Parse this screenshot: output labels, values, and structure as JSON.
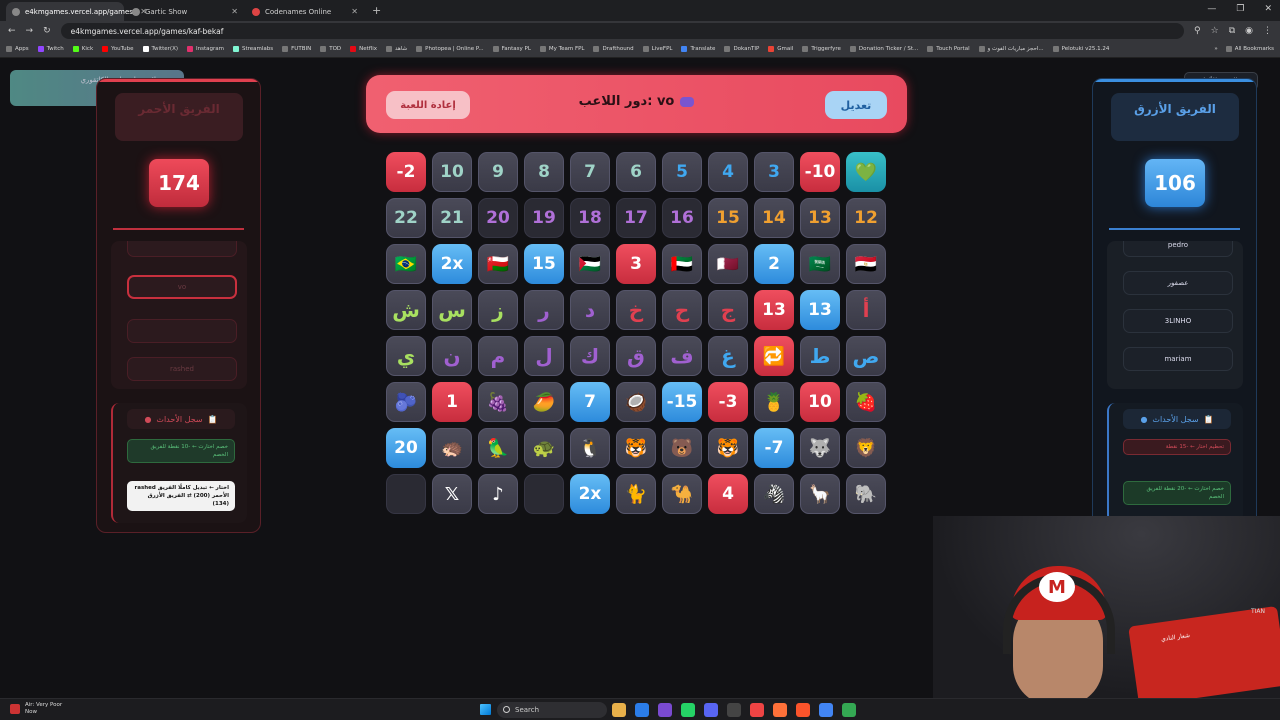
{
  "browser": {
    "tabs": [
      {
        "label": "e4kmgames.vercel.app/games/",
        "active": true
      },
      {
        "label": "Gartic Show",
        "active": false
      },
      {
        "label": "Codenames Online",
        "active": false
      }
    ],
    "new_tab": "+",
    "url": "e4kmgames.vercel.app/games/kaf-bekaf",
    "bookmarks": [
      "Apps",
      "Twitch",
      "Kick",
      "YouTube",
      "Twitter(X)",
      "Instagram",
      "Streamlabs",
      "FUTBIN",
      "TOD",
      "Netflix",
      "شاهد",
      "Photopea | Online P...",
      "Fantasy PL",
      "My Team FPL",
      "Drafthound",
      "LiveFPL",
      "Translate",
      "DokanTIP",
      "Gmail",
      "Triggerfyre",
      "Donation Ticker / St...",
      "Touch Portal",
      "احجز مباريات الفوت و...",
      "Pelotuki v25.1.24"
    ],
    "all_bookmarks": "All Bookmarks"
  },
  "toast": {
    "line1": "لا تنسوا تحطون الكاتقوري",
    "line2": "للعبة"
  },
  "back_button": "العودة للألعاب →",
  "header": {
    "restart": "إعادة اللعبة",
    "turn": "دور اللاعب: vo",
    "edit": "تعديل"
  },
  "red_team": {
    "title": "الفريق الأحمر",
    "score": "174",
    "players": [
      "",
      "vo",
      "",
      "rashed"
    ],
    "log_title": "سجل الأحداث",
    "log": [
      {
        "text": "خصم اختارت ← -10 نقطة للفريق الخصم",
        "style": "green"
      },
      {
        "text": "rashed اختار ← تبديل كاملًا الفريق الأحمر (200) ⇄ الفريق الأزرق (134)",
        "style": "white"
      }
    ]
  },
  "blue_team": {
    "title": "الفريق الأزرق",
    "score": "106",
    "players": [
      "pedro",
      "عصفور",
      "3LINHO",
      "mariam"
    ],
    "log_title": "سجل الأحداث",
    "log": [
      {
        "text": "تحطيم اختار ← -15 نقطة",
        "style": "red"
      },
      {
        "text": "خصم اختارت ← -20 نقطة للفريق الخصم",
        "style": "green"
      }
    ]
  },
  "board": [
    [
      "-2",
      "10",
      "9",
      "8",
      "7",
      "6",
      "5",
      "4",
      "3",
      "-10",
      "💚"
    ],
    [
      "22",
      "21",
      "20",
      "19",
      "18",
      "17",
      "16",
      "15",
      "14",
      "13",
      "12"
    ],
    [
      "🇧🇷",
      "2x",
      "🇴🇲",
      "15",
      "🇵🇸",
      "3",
      "🇦🇪",
      "🇶🇦",
      "2",
      "🇸🇦",
      "🇪🇬"
    ],
    [
      "ش",
      "س",
      "ز",
      "ر",
      "د",
      "خ",
      "ح",
      "ج",
      "13",
      "13",
      "أ"
    ],
    [
      "ي",
      "ن",
      "م",
      "ل",
      "ك",
      "ق",
      "ف",
      "غ",
      "🔁",
      "ط",
      "ص"
    ],
    [
      "🫐",
      "1",
      "🍇",
      "🥭",
      "7",
      "🥥",
      "-15",
      "-3",
      "🍍",
      "10",
      "🍓"
    ],
    [
      "20",
      "🦔",
      "🦜",
      "🐢",
      "🐧",
      "🐯",
      "🐻",
      "🐯",
      "-7",
      "🐺",
      "🦁"
    ],
    [
      "",
      "𝕏",
      "♪",
      "",
      "2x",
      "🐈",
      "🐪",
      "4",
      "🦓",
      "🦙",
      "🐘"
    ]
  ],
  "board_colors": [
    [
      "red",
      "gray",
      "gray",
      "gray",
      "gray",
      "gray",
      "gray",
      "gray",
      "gray",
      "red",
      "teal"
    ],
    [
      "gray",
      "gray",
      "dim",
      "dim",
      "dim",
      "dim",
      "dim",
      "gray",
      "gray",
      "gray",
      "gray"
    ],
    [
      "gray",
      "blue",
      "gray",
      "blue",
      "gray",
      "red",
      "gray",
      "gray",
      "blue",
      "gray",
      "gray"
    ],
    [
      "gray",
      "gray",
      "gray",
      "gray",
      "gray",
      "gray",
      "gray",
      "gray",
      "red",
      "blue",
      "gray"
    ],
    [
      "gray",
      "gray",
      "gray",
      "gray",
      "gray",
      "gray",
      "gray",
      "gray",
      "red",
      "gray",
      "gray"
    ],
    [
      "gray",
      "red",
      "gray",
      "gray",
      "blue",
      "gray",
      "blue",
      "red",
      "gray",
      "red",
      "gray"
    ],
    [
      "blue",
      "gray",
      "gray",
      "gray",
      "gray",
      "gray",
      "gray",
      "gray",
      "blue",
      "gray",
      "gray"
    ],
    [
      "dim",
      "gray",
      "gray",
      "dim",
      "blue",
      "gray",
      "gray",
      "red",
      "gray",
      "gray",
      "gray"
    ]
  ],
  "text_colors": {
    "number": "#9fd3c7",
    "purple": "#b070d8",
    "orange": "#f0a030",
    "letter_green": "#a8e060",
    "letter_purple": "#a060d0",
    "letter_red": "#e04050",
    "letter_blue": "#40a8f0"
  },
  "taskbar": {
    "weather_line1": "Air: Very Poor",
    "weather_line2": "Now",
    "search": "Search"
  },
  "webcam": {
    "cap_letter": "M",
    "flag_text": "شعار النادي",
    "flag_tail": "TIAN"
  }
}
